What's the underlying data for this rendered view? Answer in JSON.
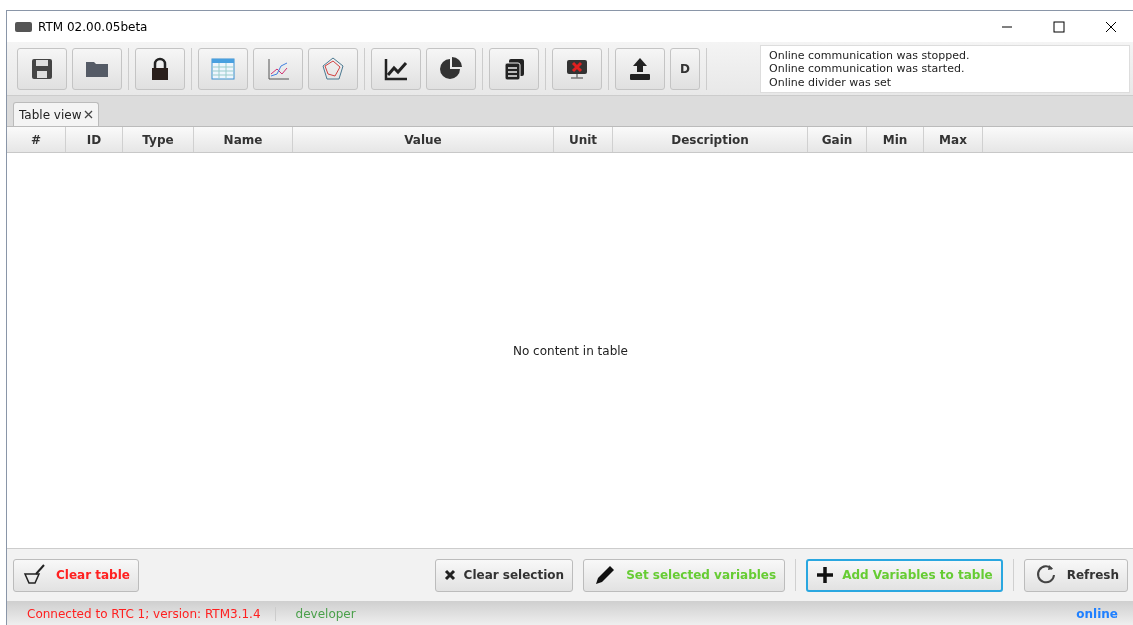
{
  "window": {
    "title": "RTM 02.00.05beta"
  },
  "toolbar": {
    "groups": [
      [
        {
          "kind": "save"
        },
        {
          "kind": "folder"
        }
      ],
      [
        {
          "kind": "lock"
        }
      ],
      [
        {
          "kind": "table"
        },
        {
          "kind": "linechart"
        },
        {
          "kind": "radar"
        }
      ],
      [
        {
          "kind": "trend"
        },
        {
          "kind": "pie"
        }
      ],
      [
        {
          "kind": "documents"
        }
      ],
      [
        {
          "kind": "monitor"
        }
      ],
      [
        {
          "kind": "upload"
        },
        {
          "kind": "text",
          "label": "D"
        }
      ]
    ]
  },
  "log": [
    "Online communication was stopped.",
    "Online communication was started.",
    "Online divider was set"
  ],
  "tabs": [
    {
      "label": "Table view",
      "selected": true
    }
  ],
  "table": {
    "columns": [
      "#",
      "ID",
      "Type",
      "Name",
      "Value",
      "Unit",
      "Description",
      "Gain",
      "Min",
      "Max"
    ],
    "empty_message": "No content in table"
  },
  "actions": [
    {
      "kind": "brush",
      "label": "Clear table",
      "color": "#ff2020",
      "focused": false
    },
    {
      "kind": "cross",
      "label": "Clear selection",
      "color": "#333333",
      "focused": false
    },
    {
      "kind": "pencil",
      "label": "Set selected variables",
      "color": "#66cc33",
      "focused": false
    },
    {
      "kind": "plus",
      "label": "Add Variables to table",
      "color": "#66cc33",
      "focused": true
    },
    {
      "kind": "refresh",
      "label": "Refresh",
      "color": "#333333",
      "focused": false
    }
  ],
  "status_bar": {
    "connection": "Connected to RTC 1; version: RTM3.1.4",
    "user": "developer",
    "state": "online"
  }
}
